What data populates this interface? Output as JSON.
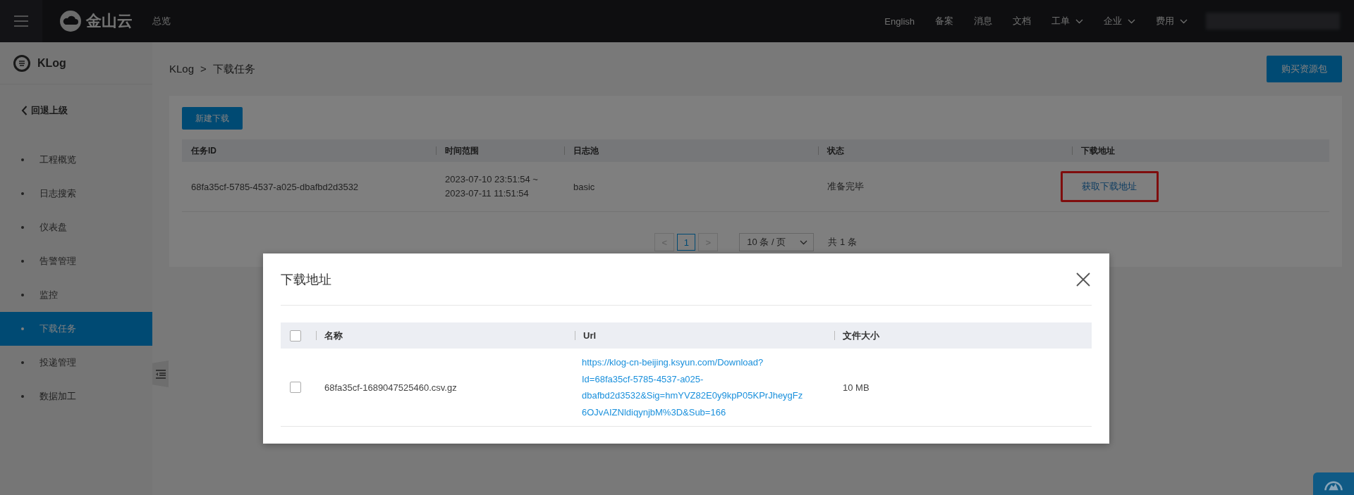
{
  "topbar": {
    "brand": "金山云",
    "overview": "总览",
    "nav": [
      {
        "label": "English",
        "dropdown": false
      },
      {
        "label": "备案",
        "dropdown": false
      },
      {
        "label": "消息",
        "dropdown": false
      },
      {
        "label": "文档",
        "dropdown": false
      },
      {
        "label": "工单",
        "dropdown": true
      },
      {
        "label": "企业",
        "dropdown": true
      },
      {
        "label": "费用",
        "dropdown": true
      }
    ]
  },
  "sidebar": {
    "title": "KLog",
    "back": "回退上级",
    "items": [
      {
        "label": "工程概览",
        "selected": false
      },
      {
        "label": "日志搜索",
        "selected": false
      },
      {
        "label": "仪表盘",
        "selected": false
      },
      {
        "label": "告警管理",
        "selected": false
      },
      {
        "label": "监控",
        "selected": false
      },
      {
        "label": "下载任务",
        "selected": true
      },
      {
        "label": "投递管理",
        "selected": false
      },
      {
        "label": "数据加工",
        "selected": false
      }
    ]
  },
  "breadcrumb": {
    "items": [
      "KLog",
      "下载任务"
    ],
    "separator": ">"
  },
  "buy_button": "购买资源包",
  "new_button": "新建下载",
  "tasks_table": {
    "columns": [
      "任务ID",
      "时间范围",
      "日志池",
      "状态",
      "下载地址"
    ],
    "rows": [
      {
        "task_id": "68fa35cf-5785-4537-a025-dbafbd2d3532",
        "time_range": [
          "2023-07-10 23:51:54 ~",
          "2023-07-11 11:51:54"
        ],
        "log_pool": "basic",
        "status": "准备完毕",
        "download": "获取下载地址",
        "highlighted": true
      }
    ]
  },
  "pagination": {
    "prev": "<",
    "next": ">",
    "pages": [
      {
        "label": "1",
        "selected": true
      }
    ],
    "page_size": "10 条 / 页",
    "total": "共 1 条"
  },
  "dialog": {
    "title": "下载地址",
    "header_checked": false,
    "columns": [
      "名称",
      "Url",
      "文件大小"
    ],
    "rows": [
      {
        "checked": false,
        "name": "68fa35cf-1689047525460.csv.gz",
        "url_lines": [
          "https://klog-cn-beijing.ksyun.com/Download?",
          "Id=68fa35cf-5785-4537-a025-",
          "dbafbd2d3532&Sig=hmYVZ82E0y9kpP05KPrJheygFz",
          "6OJvAIZNldiqynjbM%3D&Sub=166"
        ],
        "size": "10 MB"
      }
    ]
  }
}
